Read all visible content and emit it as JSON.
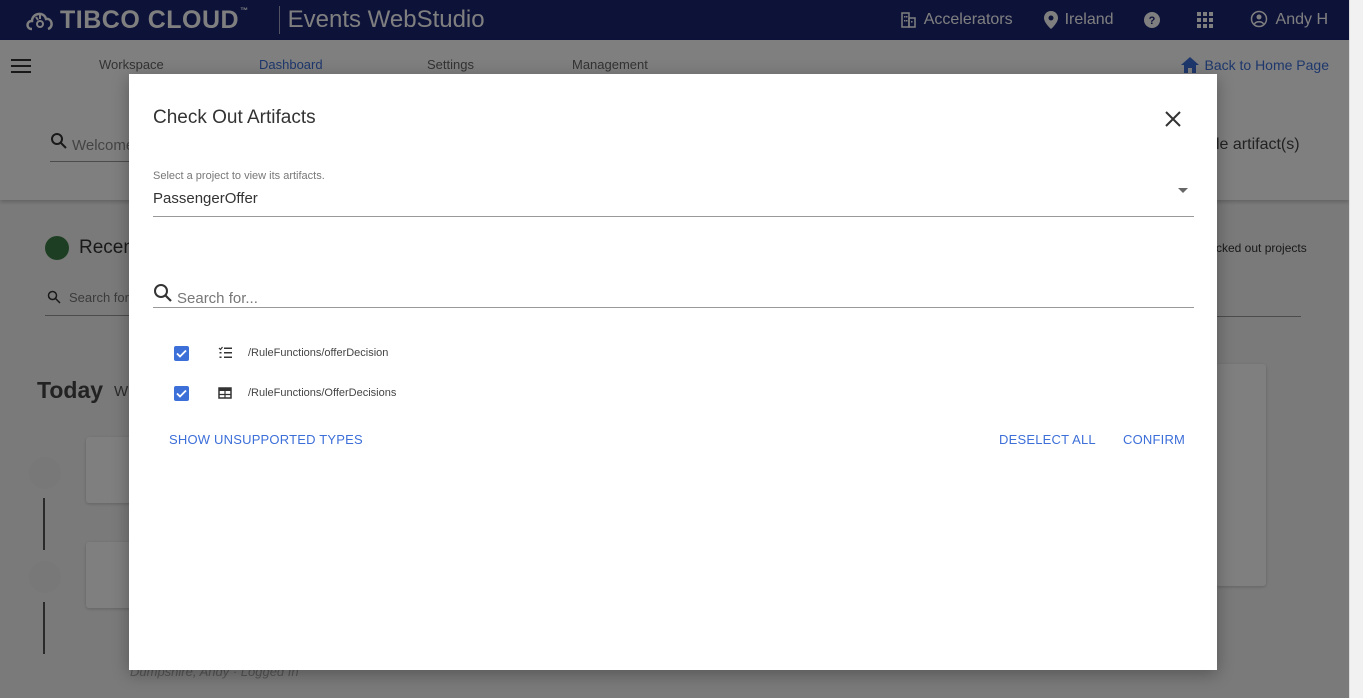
{
  "topbar": {
    "brand": "TIBCO CLOUD",
    "brand_tm": "™",
    "app_title": "Events WebStudio",
    "accelerators": "Accelerators",
    "region": "Ireland",
    "user": "Andy H"
  },
  "subnav": {
    "tabs": [
      "Workspace",
      "Dashboard",
      "Settings",
      "Management"
    ],
    "back_home": "Back to Home Page",
    "search_partial": "Welcome",
    "right_text_partial": "le artifact(s)",
    "recent_partial": "Recen",
    "checked_partial": "cked out projects",
    "search2_partial": "Search for",
    "today": "Today",
    "today_sub_partial": "W",
    "faded_text": "Dumpshire, Andy · Logged In"
  },
  "modal": {
    "title": "Check Out Artifacts",
    "project_label": "Select a project to view its artifacts.",
    "project_value": "PassengerOffer",
    "search_placeholder": "Search for...",
    "artifacts": [
      {
        "path": "/RuleFunctions/offerDecision",
        "icon": "rule-function-icon",
        "checked": true
      },
      {
        "path": "/RuleFunctions/OfferDecisions",
        "icon": "decision-table-icon",
        "checked": true
      }
    ],
    "show_unsupported": "SHOW UNSUPPORTED TYPES",
    "deselect_all": "DESELECT ALL",
    "confirm": "CONFIRM"
  },
  "colors": {
    "topbar": "#1a2473",
    "accent": "#3d6fd9"
  }
}
